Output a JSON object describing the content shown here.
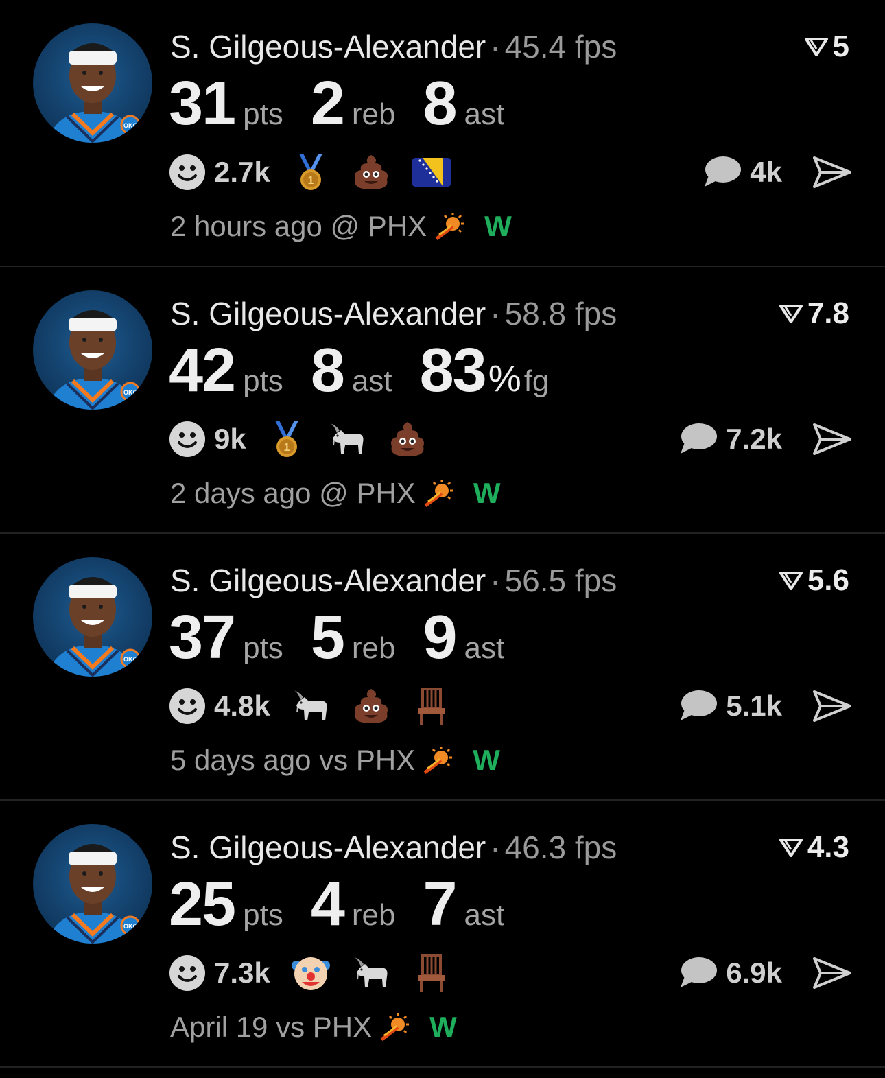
{
  "posts": [
    {
      "player": "S. Gilgeous-Alexander",
      "fps": "45.4 fps",
      "rating": "5",
      "stats": [
        {
          "value": "31",
          "unit": "pts"
        },
        {
          "value": "2",
          "unit": "reb"
        },
        {
          "value": "8",
          "unit": "ast"
        }
      ],
      "likes": "2.7k",
      "emojis": [
        "gold-medal",
        "poop",
        "bosnia-flag"
      ],
      "comments": "4k",
      "time": "2 hours ago @ PHX",
      "result": "W"
    },
    {
      "player": "S. Gilgeous-Alexander",
      "fps": "58.8 fps",
      "rating": "7.8",
      "stats": [
        {
          "value": "42",
          "unit": "pts"
        },
        {
          "value": "8",
          "unit": "ast"
        },
        {
          "value": "83",
          "pct": "%",
          "unit": "fg"
        }
      ],
      "likes": "9k",
      "emojis": [
        "gold-medal",
        "goat",
        "poop"
      ],
      "comments": "7.2k",
      "time": "2 days ago @ PHX",
      "result": "W"
    },
    {
      "player": "S. Gilgeous-Alexander",
      "fps": "56.5 fps",
      "rating": "5.6",
      "stats": [
        {
          "value": "37",
          "unit": "pts"
        },
        {
          "value": "5",
          "unit": "reb"
        },
        {
          "value": "9",
          "unit": "ast"
        }
      ],
      "likes": "4.8k",
      "emojis": [
        "goat",
        "poop",
        "chair"
      ],
      "comments": "5.1k",
      "time": "5 days ago vs PHX",
      "result": "W"
    },
    {
      "player": "S. Gilgeous-Alexander",
      "fps": "46.3 fps",
      "rating": "4.3",
      "stats": [
        {
          "value": "25",
          "unit": "pts"
        },
        {
          "value": "4",
          "unit": "reb"
        },
        {
          "value": "7",
          "unit": "ast"
        }
      ],
      "likes": "7.3k",
      "emojis": [
        "clown",
        "goat",
        "chair"
      ],
      "comments": "6.9k",
      "time": "April 19 vs PHX",
      "result": "W"
    }
  ],
  "colors": {
    "background": "#000000",
    "win": "#1fae5c",
    "muted": "#9a9a9a",
    "text": "#e8e8e8"
  },
  "icons": {
    "avatar": "player-photo-okc",
    "rating": "down-triangle-icon",
    "likes": "smile-icon",
    "comments": "speech-bubble-icon",
    "share": "send-icon",
    "team": "suns-logo-icon"
  }
}
